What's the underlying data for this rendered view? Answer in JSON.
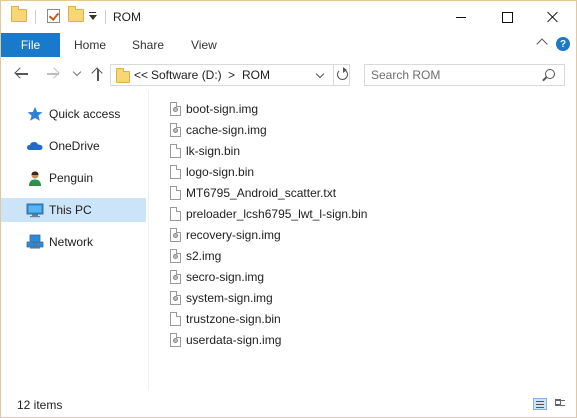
{
  "window": {
    "title": "ROM",
    "quick_access_toolbar": [
      "folder-icon",
      "properties-check-icon",
      "new-folder-icon",
      "customize-dropdown-icon"
    ]
  },
  "ribbon": {
    "file_label": "File",
    "tabs": [
      "Home",
      "Share",
      "View"
    ],
    "accent": "#1979ca"
  },
  "address": {
    "overflow_marker": "<<",
    "crumbs": [
      "Software (D:)",
      "ROM"
    ],
    "separator": ">"
  },
  "search": {
    "placeholder": "Search ROM"
  },
  "sidebar": {
    "items": [
      {
        "label": "Quick access",
        "icon": "star-icon"
      },
      {
        "label": "OneDrive",
        "icon": "cloud-icon"
      },
      {
        "label": "Penguin",
        "icon": "user-icon"
      },
      {
        "label": "This PC",
        "icon": "computer-icon",
        "selected": true
      },
      {
        "label": "Network",
        "icon": "network-icon"
      }
    ]
  },
  "files": [
    {
      "name": "boot-sign.img",
      "icon": "disc-image-file-icon"
    },
    {
      "name": "cache-sign.img",
      "icon": "disc-image-file-icon"
    },
    {
      "name": "lk-sign.bin",
      "icon": "file-icon"
    },
    {
      "name": "logo-sign.bin",
      "icon": "file-icon"
    },
    {
      "name": "MT6795_Android_scatter.txt",
      "icon": "text-file-icon"
    },
    {
      "name": "preloader_lcsh6795_lwt_l-sign.bin",
      "icon": "file-icon"
    },
    {
      "name": "recovery-sign.img",
      "icon": "disc-image-file-icon"
    },
    {
      "name": "s2.img",
      "icon": "disc-image-file-icon"
    },
    {
      "name": "secro-sign.img",
      "icon": "disc-image-file-icon"
    },
    {
      "name": "system-sign.img",
      "icon": "disc-image-file-icon"
    },
    {
      "name": "trustzone-sign.bin",
      "icon": "file-icon"
    },
    {
      "name": "userdata-sign.img",
      "icon": "disc-image-file-icon"
    }
  ],
  "status": {
    "item_count": "12 items"
  }
}
